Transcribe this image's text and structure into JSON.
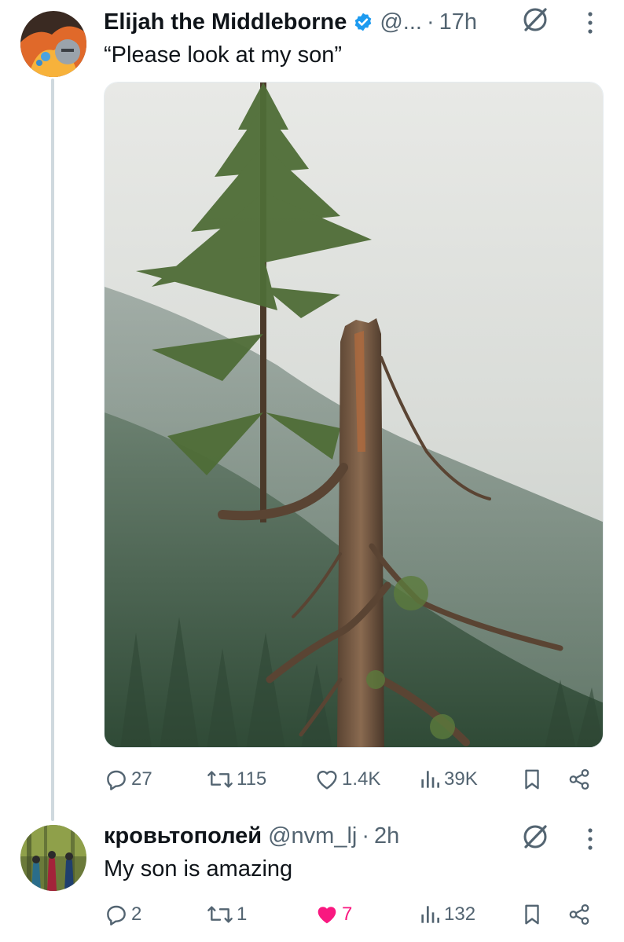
{
  "post": {
    "author_name": "Elijah the Middleborne",
    "handle": "@...",
    "separator": "·",
    "time": "17h",
    "text": "“Please look at my son”",
    "image_icon": "photo-mossy-tree",
    "actions": {
      "replies": "27",
      "reposts": "115",
      "likes": "1.4K",
      "views": "39K"
    }
  },
  "reply": {
    "author_name": "кровьтополей",
    "handle": "@nvm_lj",
    "separator": "·",
    "time": "2h",
    "text": "My son is amazing",
    "actions": {
      "replies": "2",
      "reposts": "1",
      "likes": "7",
      "views": "132"
    },
    "liked": true
  },
  "colors": {
    "text_primary": "#0f1419",
    "text_secondary": "#536471",
    "verified": "#1d9bf0",
    "like_active": "#f91880",
    "thread_line": "#cfd9de"
  }
}
